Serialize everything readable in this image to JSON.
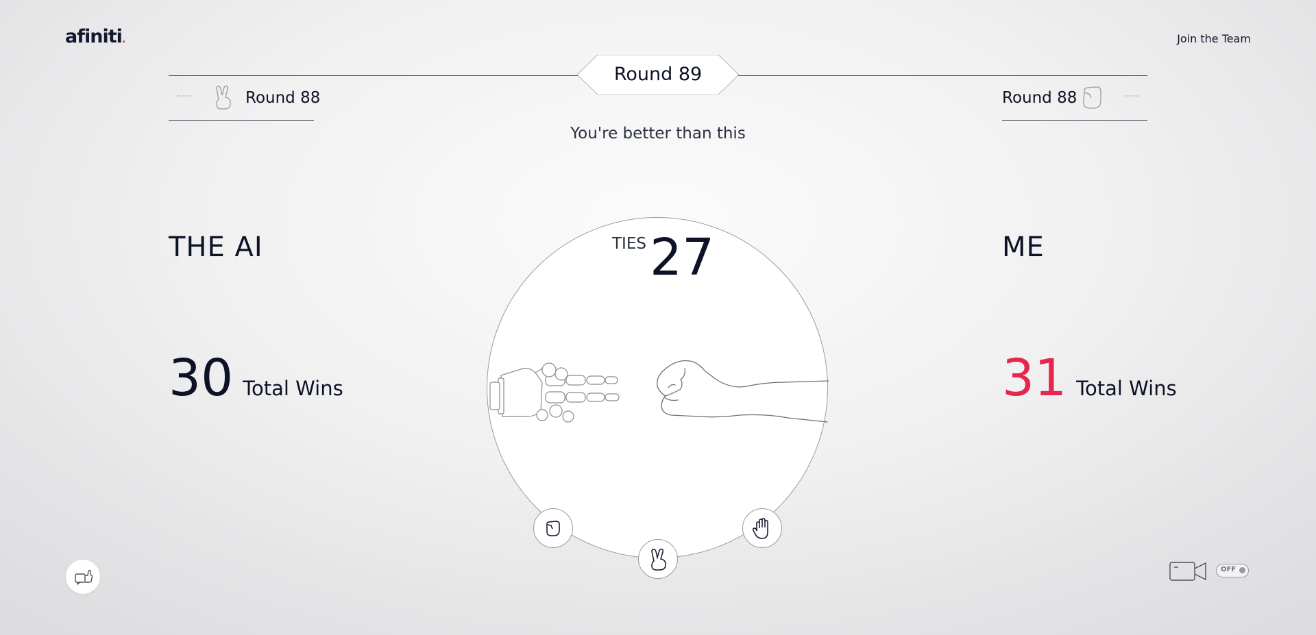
{
  "header": {
    "logo_text": "afiniti",
    "logo_dot": ".",
    "join_link": "Join the Team"
  },
  "round": {
    "current": "Round 89",
    "prev_label": "Round 88",
    "prev_hand": "peace-hand-icon",
    "next_label": "Round 88",
    "next_hand": "fist-hand-icon"
  },
  "subtitle": "You're better than this",
  "ai": {
    "label": "THE AI",
    "wins": "30",
    "wins_label": "Total Wins",
    "last_move": "scissors"
  },
  "me": {
    "label": "ME",
    "wins": "31",
    "wins_label": "Total Wins",
    "last_move": "rock",
    "wins_color": "#e6264c"
  },
  "ties": {
    "label": "TIES",
    "count": "27"
  },
  "choices": [
    {
      "name": "rock",
      "icon": "fist-icon"
    },
    {
      "name": "scissors",
      "icon": "peace-icon"
    },
    {
      "name": "paper",
      "icon": "open-hand-icon"
    }
  ],
  "camera_toggle": {
    "state": "OFF",
    "icon": "video-camera-icon"
  },
  "feedback_icon": "thumbs-up-icon",
  "colors": {
    "text": "#0d1226",
    "accent": "#e6264c",
    "outline": "#9a9a9f"
  }
}
